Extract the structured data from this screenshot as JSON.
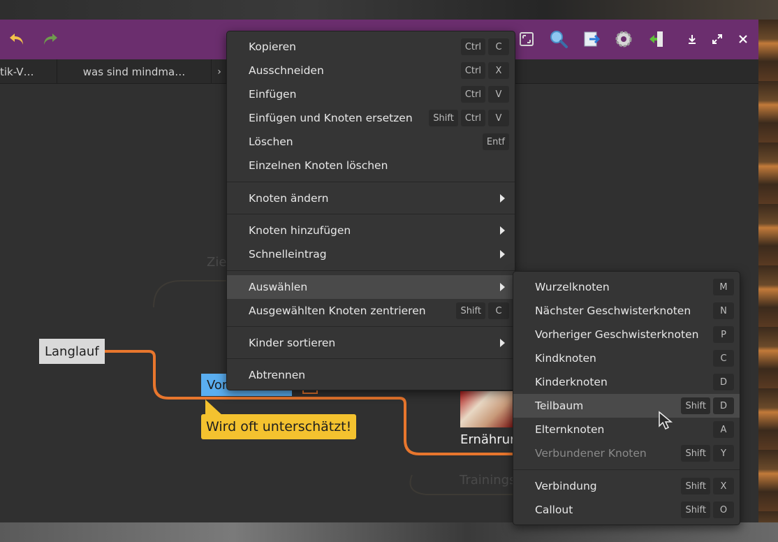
{
  "tabs": [
    "tik-V…",
    "was sind mindma…"
  ],
  "nodes": {
    "langlauf": "Langlauf",
    "vor_partial": "Vor",
    "callout": "Wird oft unterschätzt!",
    "ernaehrung_partial": "Ernährun",
    "faint_zie": "Zie",
    "faint_training": "Trainings"
  },
  "context_menu": {
    "items": [
      {
        "label": "Kopieren",
        "keys": [
          "Ctrl",
          "C"
        ]
      },
      {
        "label": "Ausschneiden",
        "keys": [
          "Ctrl",
          "X"
        ]
      },
      {
        "label": "Einfügen",
        "keys": [
          "Ctrl",
          "V"
        ]
      },
      {
        "label": "Einfügen und Knoten ersetzen",
        "keys": [
          "Shift",
          "Ctrl",
          "V"
        ]
      },
      {
        "label": "Löschen",
        "keys": [
          "Entf"
        ]
      },
      {
        "label": "Einzelnen Knoten löschen",
        "keys": []
      },
      {
        "label": "Knoten ändern",
        "submenu": true
      },
      {
        "label": "Knoten hinzufügen",
        "submenu": true
      },
      {
        "label": "Schnelleintrag",
        "submenu": true
      },
      {
        "label": "Auswählen",
        "submenu": true,
        "highlighted": true
      },
      {
        "label": "Ausgewählten Knoten zentrieren",
        "keys": [
          "Shift",
          "C"
        ]
      },
      {
        "label": "Kinder sortieren",
        "submenu": true
      },
      {
        "label": "Abtrennen",
        "keys": []
      }
    ]
  },
  "submenu_auswaehlen": {
    "items": [
      {
        "label": "Wurzelknoten",
        "keys": [
          "M"
        ]
      },
      {
        "label": "Nächster Geschwisterknoten",
        "keys": [
          "N"
        ]
      },
      {
        "label": "Vorheriger Geschwisterknoten",
        "keys": [
          "P"
        ]
      },
      {
        "label": "Kindknoten",
        "keys": [
          "C"
        ]
      },
      {
        "label": "Kinderknoten",
        "keys": [
          "D"
        ]
      },
      {
        "label": "Teilbaum",
        "keys": [
          "Shift",
          "D"
        ],
        "highlighted": true
      },
      {
        "label": "Elternknoten",
        "keys": [
          "A"
        ]
      },
      {
        "label": "Verbundener Knoten",
        "keys": [
          "Shift",
          "Y"
        ],
        "disabled": true
      },
      {
        "label": "Verbindung",
        "keys": [
          "Shift",
          "X"
        ]
      },
      {
        "label": "Callout",
        "keys": [
          "Shift",
          "O"
        ]
      }
    ]
  },
  "colors": {
    "headerbar": "#6b2e6e",
    "connector": "#e8762d",
    "callout": "#f4c22f",
    "selected_node": "#5aaef0"
  },
  "icons": [
    "undo-icon",
    "redo-icon",
    "zoom-fit-icon",
    "search-icon",
    "export-icon",
    "settings-icon",
    "sidebar-icon",
    "download-icon",
    "fullscreen-icon",
    "close-icon"
  ]
}
